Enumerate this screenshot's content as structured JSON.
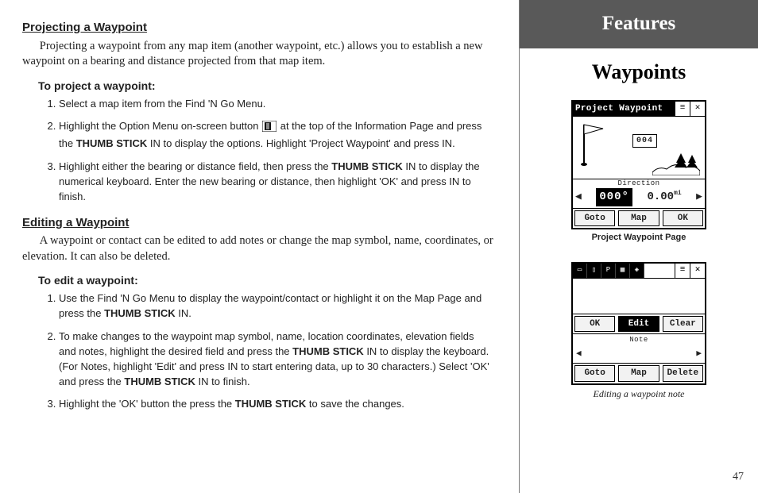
{
  "page_number": "47",
  "sidebar": {
    "banner": "Features",
    "title": "Waypoints",
    "shot1": {
      "title": "Project Waypoint",
      "num": "004",
      "dir_label": "Direction",
      "bearing": "000°",
      "distance": "0.00",
      "unit": "mi",
      "buttons": [
        "Goto",
        "Map",
        "OK"
      ],
      "caption": "Project Waypoint Page"
    },
    "shot2": {
      "buttons_top": [
        "OK",
        "Edit",
        "Clear"
      ],
      "note_label": "Note",
      "buttons_bottom": [
        "Goto",
        "Map",
        "Delete"
      ],
      "caption": "Editing a waypoint note"
    }
  },
  "s1_heading": "Projecting a Waypoint",
  "s1_para": "Projecting a waypoint from any map item (another waypoint, etc.) allows you to establish a new waypoint on a bearing and distance projected from that map item.",
  "s1_howto": "To project a waypoint:",
  "s1_step1": "Select a map item from the Find 'N Go Menu.",
  "s1_step2a": "Highlight the Option Menu on-screen button ",
  "s1_step2b": " at the top of the Information Page and press the ",
  "s1_step2c": "THUMB STICK",
  "s1_step2d": " IN to display the options.  Highlight 'Project Waypoint' and press IN.",
  "s1_step3a": "Highlight either the bearing or distance field, then press the ",
  "s1_step3b": "THUMB STICK",
  "s1_step3c": " IN to display the numerical keyboard.  Enter the new bearing or distance, then highlight 'OK' and press IN to finish.",
  "s2_heading": "Editing a Waypoint",
  "s2_para": "A waypoint or contact can be edited to add notes or change the map symbol, name, coordinates, or elevation.  It can also be deleted.",
  "s2_howto": "To edit a waypoint:",
  "s2_step1a": "Use the Find 'N Go Menu to display the waypoint/contact or highlight it on the Map Page and press the ",
  "s2_step1b": "THUMB STICK",
  "s2_step1c": " IN.",
  "s2_step2a": "To make changes to the waypoint map symbol, name, location coordinates, elevation fields and notes, highlight the desired field and press the ",
  "s2_step2b": "THUMB STICK",
  "s2_step2c": " IN to display the keyboard.  (For Notes, highlight 'Edit' and press IN to start entering data, up to 30 characters.) Select 'OK' and press the ",
  "s2_step2d": "THUMB STICK",
  "s2_step2e": " IN to finish.",
  "s2_step3a": "Highlight the 'OK' button the press the ",
  "s2_step3b": "THUMB STICK",
  "s2_step3c": " to save the changes."
}
